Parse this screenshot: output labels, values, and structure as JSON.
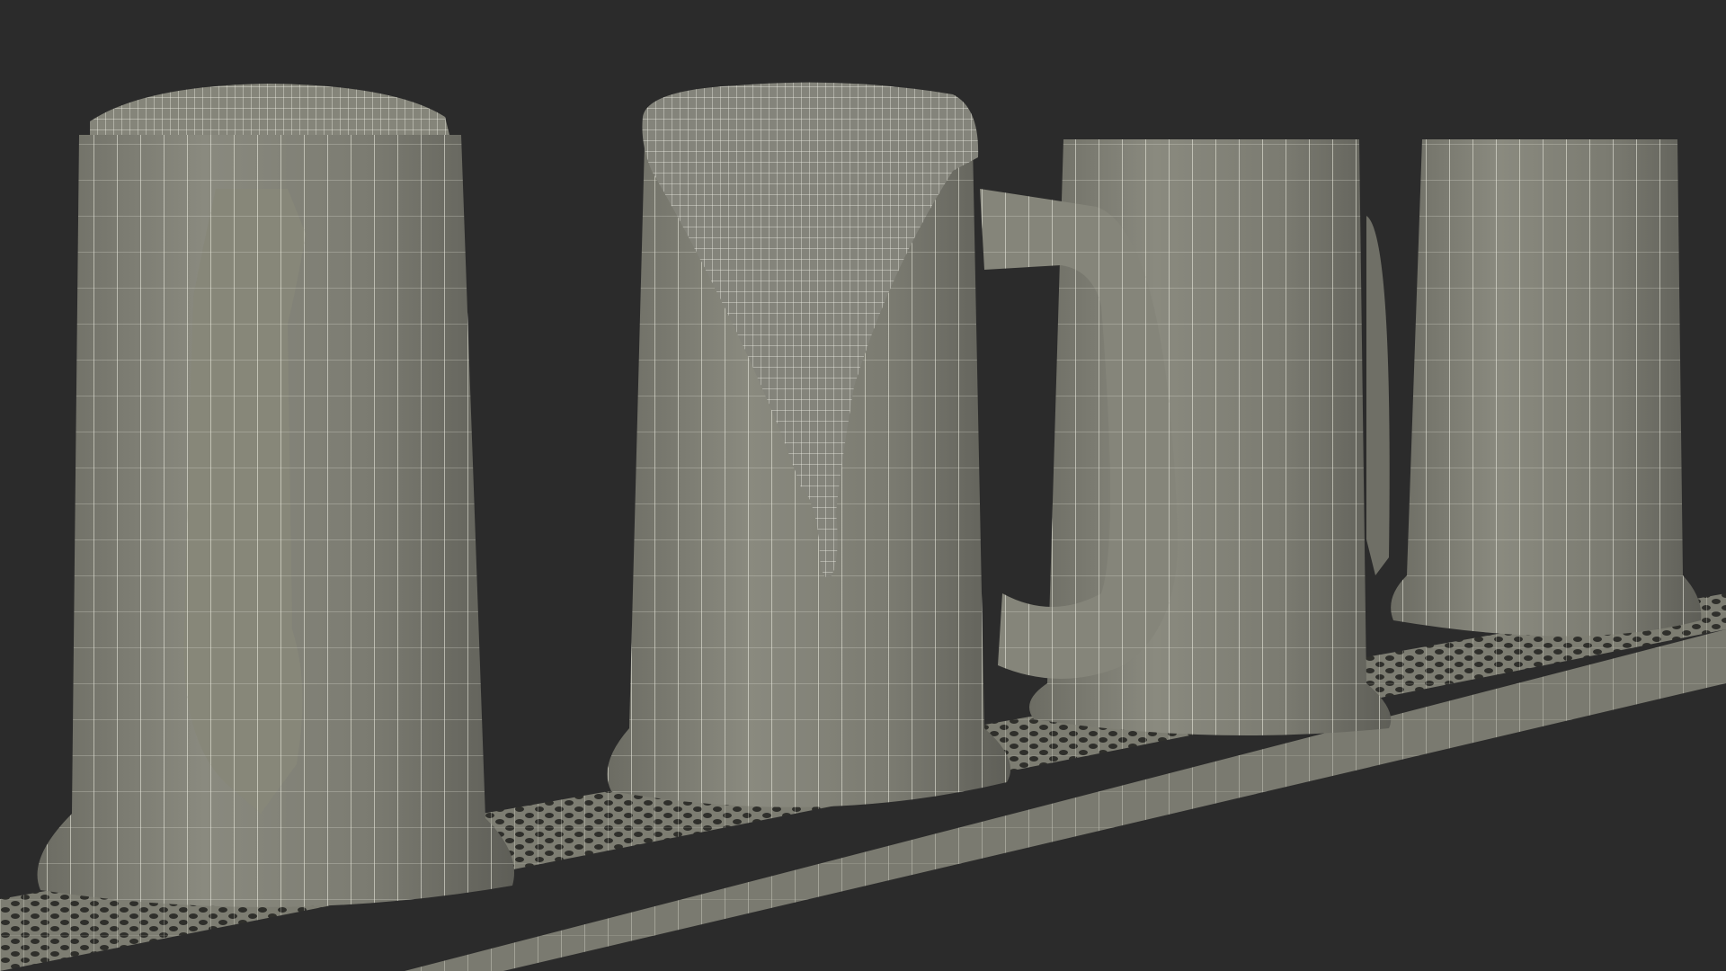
{
  "scene": {
    "background_color": "#2b2b2b",
    "mesh_fill": "#7d7d72",
    "mesh_shadow": "#5d5d55",
    "mesh_highlight": "#8f8f84",
    "wire_color": "#e8e8dc",
    "mug_count": 4,
    "objects": [
      {
        "name": "mug-with-lid",
        "has_handle": true,
        "handle_side": "front"
      },
      {
        "name": "mug-with-foam",
        "has_handle": true,
        "handle_side": "right",
        "foam": true
      },
      {
        "name": "plain-mug-3",
        "has_handle": true,
        "handle_side": "right-partial"
      },
      {
        "name": "plain-mug-4",
        "has_handle": false
      }
    ],
    "tray": {
      "name": "drip-tray",
      "pattern": "hexagonal-holes"
    }
  }
}
